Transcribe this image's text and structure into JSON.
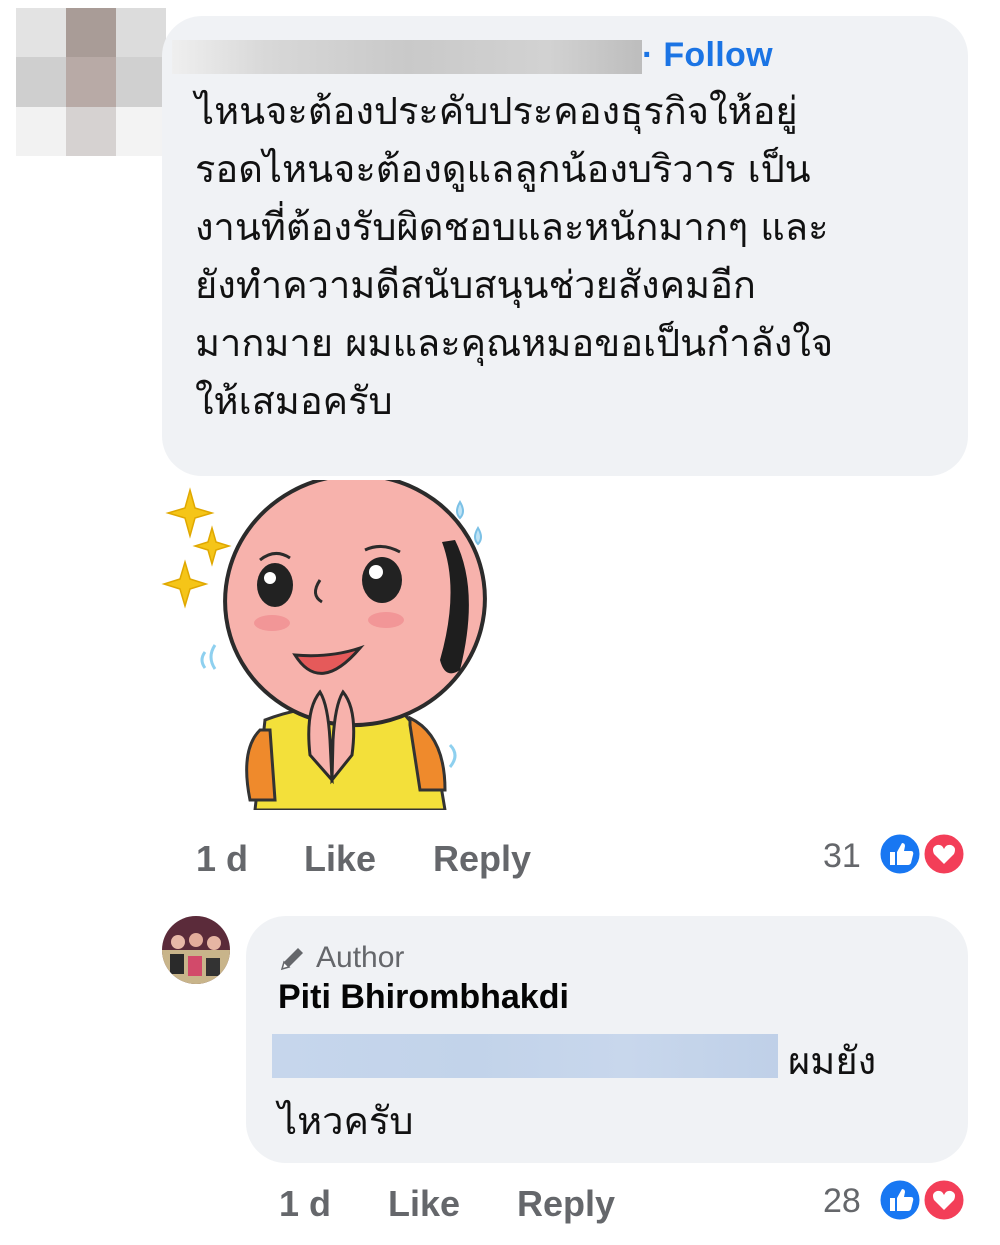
{
  "comment": {
    "follow_label": "· Follow",
    "text_lines": [
      "ไหนจะต้องประคับประคองธุรกิจให้อยู่",
      "รอดไหนจะต้องดูแลลูกน้องบริวาร เป็น",
      "งานที่ต้องรับผิดชอบและหนักมากๆ และ",
      "ยังทำความดีสนับสนุนช่วยสังคมอีก",
      "มากมาย ผมและคุณหมอขอเป็นกำลังใจ",
      "ให้เสมอครับ"
    ],
    "time": "1 d",
    "like_label": "Like",
    "reply_label": "Reply",
    "reaction_count": "31",
    "reaction_icons": [
      "like-icon",
      "love-icon"
    ]
  },
  "reply": {
    "author_badge": "Author",
    "author_icon": "pencil-icon",
    "name": "Piti Bhirombhakdi",
    "text_line1": "ผมยัง",
    "text_line2": "ไหวครับ",
    "time": "1 d",
    "like_label": "Like",
    "reply_label": "Reply",
    "reaction_count": "28",
    "reaction_icons": [
      "like-icon",
      "love-icon"
    ]
  },
  "colors": {
    "bubble": "#f0f2f5",
    "link_blue": "#1b74e4",
    "meta_grey": "#65676b",
    "like_blue": "#1877f2",
    "love_red": "#f33e58"
  }
}
